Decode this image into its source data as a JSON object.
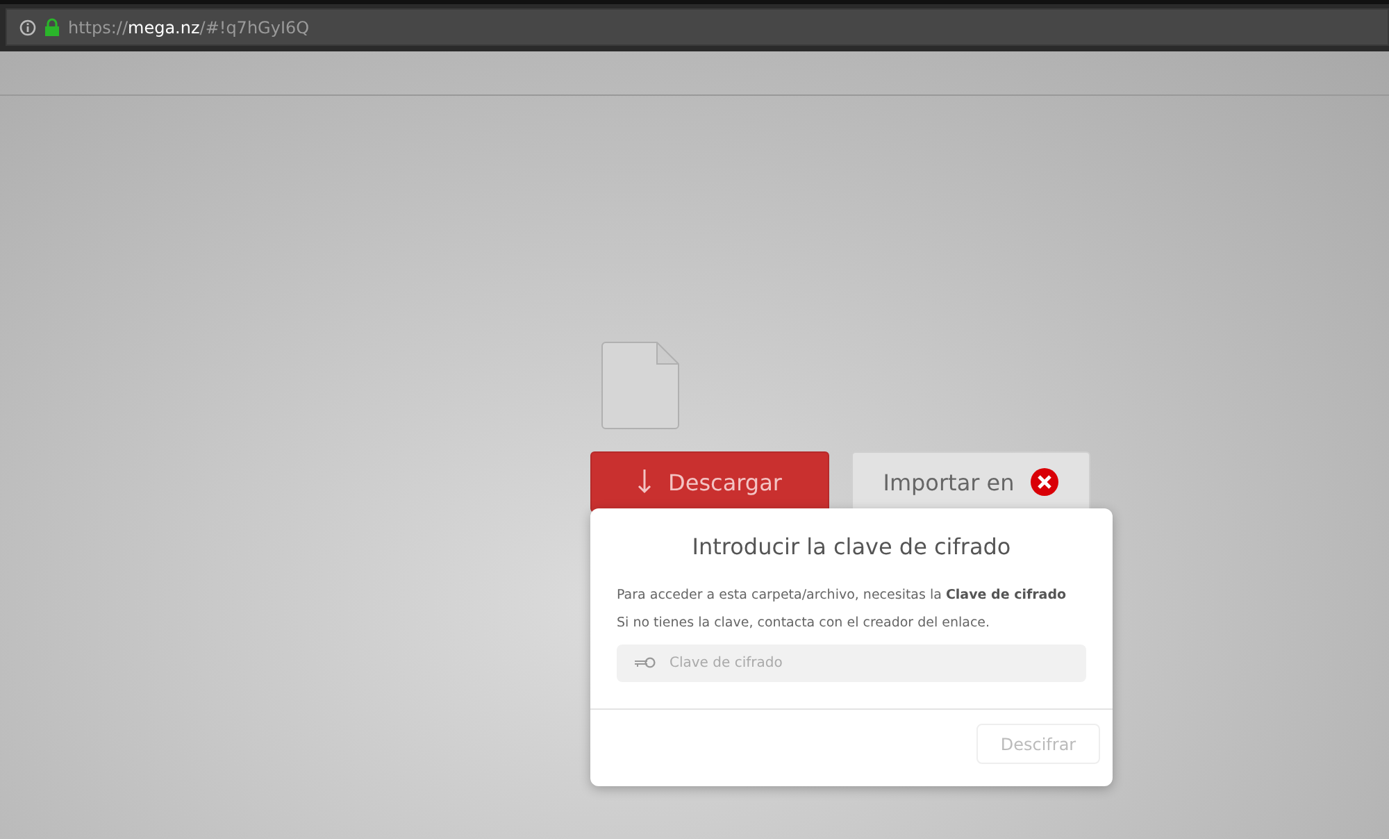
{
  "address_bar": {
    "scheme": "https://",
    "host": "mega.nz",
    "path": "/#!q7hGyI6Q",
    "secure": true
  },
  "actions": [
    {
      "kind": "primary",
      "label": "Descargar"
    },
    {
      "kind": "secondary",
      "label": "Importar en"
    }
  ],
  "dialog": {
    "title": "Introducir la clave de cifrado",
    "messages": [
      "Para acceder a esta carpeta/archivo, necesitas la **Clave de cifrado**",
      "Si no tienes la clave, contacta con el creador del enlace."
    ],
    "key_field": {
      "placeholder": "Clave de cifrado"
    },
    "button": {
      "label": "Descifrar",
      "disabled": true
    }
  }
}
